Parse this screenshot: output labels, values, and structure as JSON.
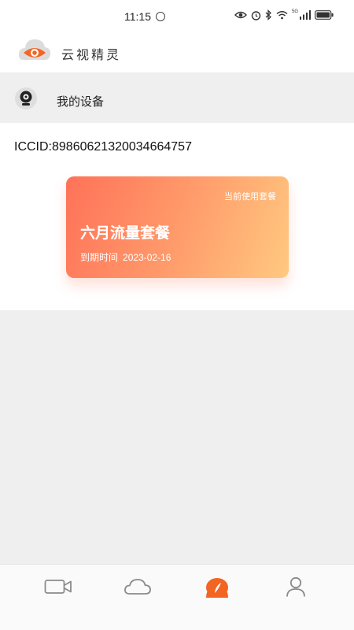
{
  "status_bar": {
    "time": "11:15",
    "icons": [
      "eye-icon",
      "alarm-icon",
      "bluetooth-icon",
      "wifi-icon",
      "5g-signal-icon",
      "battery-icon"
    ],
    "network_label": "5G"
  },
  "header": {
    "app_title": "云视精灵",
    "logo": "cloud-eye-logo"
  },
  "device_section": {
    "label": "我的设备",
    "icon": "camera-icon"
  },
  "iccid": "ICCID:89860621320034664757",
  "plan_card": {
    "tag": "当前使用套餐",
    "name": "六月流量套餐",
    "expiry_label": "到期时间",
    "expiry_date": "2023-02-16",
    "gradient_start": "#ff7258",
    "gradient_end": "#ffc980"
  },
  "bottom_nav": {
    "items": [
      {
        "icon": "video-camera-icon",
        "active": false
      },
      {
        "icon": "cloud-icon",
        "active": false
      },
      {
        "icon": "flow-leaf-icon",
        "active": true
      },
      {
        "icon": "user-icon",
        "active": false
      }
    ],
    "active_color": "#f26522",
    "inactive_color": "#8a8a8a"
  }
}
